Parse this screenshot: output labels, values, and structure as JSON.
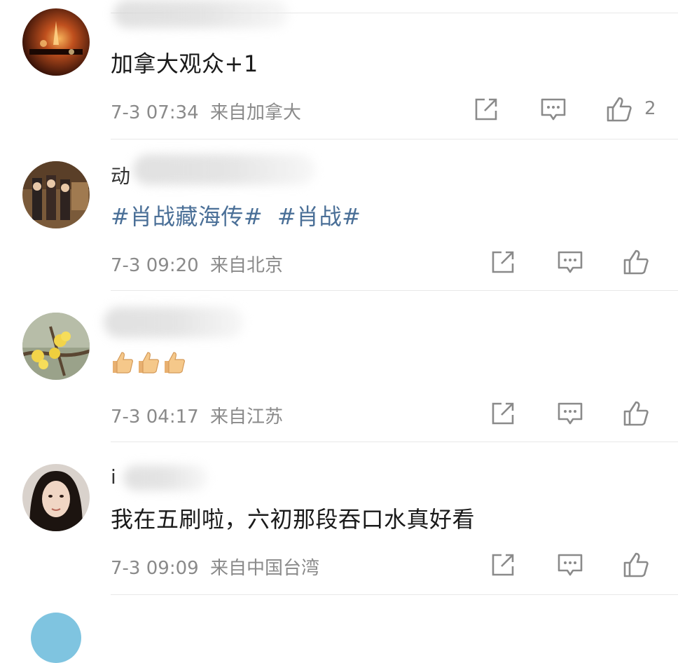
{
  "comments": [
    {
      "username": "",
      "text": "加拿大观众+1",
      "time": "7-3 07:34",
      "source": "来自加拿大",
      "like_count": "2"
    },
    {
      "username": "动",
      "topics": [
        "#肖战藏海传#",
        "#肖战#"
      ],
      "time": "7-3 09:20",
      "source": "来自北京",
      "like_count": ""
    },
    {
      "username": "",
      "text": "",
      "emojis": [
        "thumbs-up",
        "thumbs-up",
        "thumbs-up"
      ],
      "time": "7-3 04:17",
      "source": "来自江苏",
      "like_count": ""
    },
    {
      "username": "i",
      "text": "我在五刷啦，六初那段吞口水真好看",
      "time": "7-3 09:09",
      "source": "来自中国台湾",
      "like_count": ""
    }
  ],
  "icons": {
    "repost": "share-icon",
    "comment": "comment-icon",
    "like": "like-icon"
  },
  "colors": {
    "topic": "#4a6f97",
    "meta": "#8a8a8a",
    "divider": "#e8e8e8"
  }
}
